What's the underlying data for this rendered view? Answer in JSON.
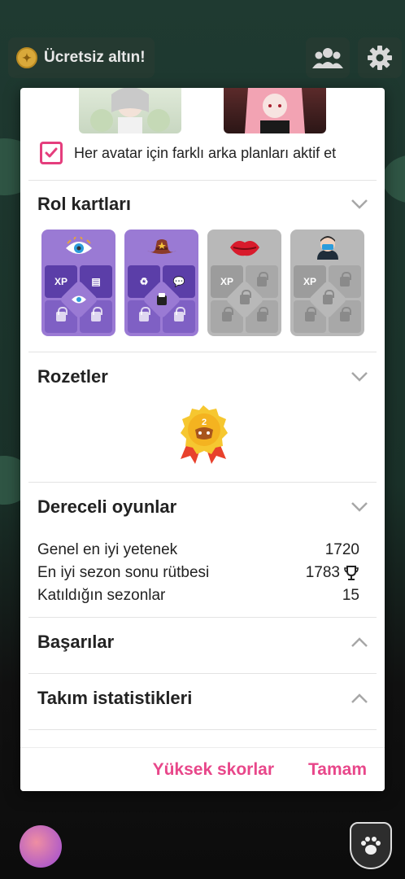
{
  "top_bar": {
    "free_gold_label": "Ücretsiz altın!",
    "icons": [
      "coin-icon",
      "friends-icon",
      "gear-icon"
    ]
  },
  "dialog": {
    "avatar_bg_checkbox": {
      "label": "Her avatar için farklı arka planları aktif et",
      "checked": true
    },
    "sections": {
      "role_cards": {
        "title": "Rol kartları",
        "cards": [
          {
            "name": "seer",
            "top_icon": "eye-icon",
            "locked": false,
            "cells": [
              "XP",
              "clipboard",
              "lock",
              "lock"
            ]
          },
          {
            "name": "sheriff",
            "top_icon": "cowboy-hat-icon",
            "locked": false,
            "cells": [
              "recycle",
              "chat",
              "lock",
              "lock"
            ]
          },
          {
            "name": "kiss",
            "top_icon": "lips-icon",
            "locked": true,
            "cells": [
              "XP",
              "lock",
              "lock",
              "lock"
            ]
          },
          {
            "name": "doctor",
            "top_icon": "mask-person-icon",
            "locked": true,
            "cells": [
              "XP",
              "lock",
              "lock",
              "lock"
            ]
          }
        ]
      },
      "badges": {
        "title": "Rozetler",
        "badge_number": "2"
      },
      "ranked": {
        "title": "Dereceli oyunlar",
        "stats": [
          {
            "label": "Genel en iyi yetenek",
            "value": "1720"
          },
          {
            "label": "En iyi sezon sonu rütbesi",
            "value": "1783"
          },
          {
            "label": "Katıldığın sezonlar",
            "value": "15"
          }
        ]
      },
      "achievements": {
        "title": "Başarılar"
      },
      "team_stats": {
        "title": "Takım istatistikleri"
      }
    },
    "footer": {
      "high_scores_label": "Yüksek skorlar",
      "ok_label": "Tamam"
    }
  },
  "colors": {
    "accent": "#e8478a",
    "checkbox": "#e53e7d",
    "role_card_unlocked": "#9a7ad4",
    "role_card_locked": "#b8b8b8"
  }
}
